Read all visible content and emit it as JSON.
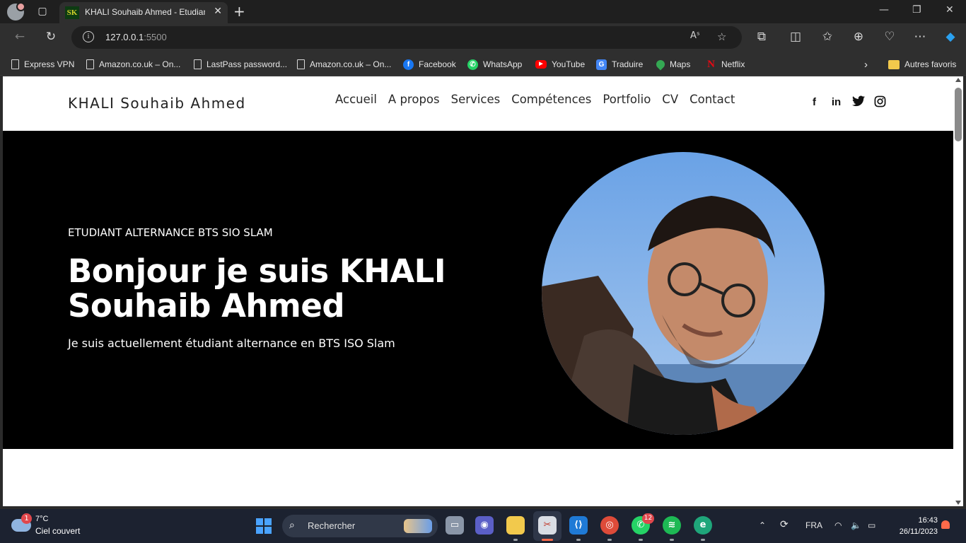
{
  "browser": {
    "tab": {
      "title": "KHALI Souhaib Ahmed - Etudiant",
      "favicon_text": "SK"
    },
    "url": {
      "host": "127.0.0.1",
      "port": ":5500"
    },
    "read_aloud_label": "Aˢ",
    "bookmarks": [
      {
        "label": "Express VPN",
        "icon": "page-icon"
      },
      {
        "label": "Amazon.co.uk – On...",
        "icon": "page-icon"
      },
      {
        "label": "LastPass password...",
        "icon": "page-icon"
      },
      {
        "label": "Amazon.co.uk – On...",
        "icon": "page-icon"
      },
      {
        "label": "Facebook",
        "icon": "facebook-icon"
      },
      {
        "label": "WhatsApp",
        "icon": "whatsapp-icon"
      },
      {
        "label": "YouTube",
        "icon": "youtube-icon"
      },
      {
        "label": "Traduire",
        "icon": "translate-icon"
      },
      {
        "label": "Maps",
        "icon": "maps-icon"
      },
      {
        "label": "Netflix",
        "icon": "netflix-icon"
      }
    ],
    "other_favorites": "Autres favoris"
  },
  "site": {
    "logo": "KHALI Souhaib Ahmed",
    "nav": [
      "Accueil",
      "A propos",
      "Services",
      "Compétences",
      "Portfolio",
      "CV",
      "Contact"
    ],
    "socials": [
      {
        "icon": "facebook-icon",
        "glyph": "f"
      },
      {
        "icon": "linkedin-icon",
        "glyph": "in"
      },
      {
        "icon": "twitter-icon",
        "glyph": "🐦"
      },
      {
        "icon": "instagram-icon",
        "glyph": "◎"
      }
    ],
    "hero": {
      "subtitle": "ETUDIANT ALTERNANCE BTS SIO SLAM",
      "title": "Bonjour je suis KHALI Souhaib Ahmed",
      "description": "Je suis actuellement étudiant alternance en BTS ISO Slam"
    }
  },
  "taskbar": {
    "weather": {
      "badge": "1",
      "temp": "7°C",
      "condition": "Ciel couvert"
    },
    "search_placeholder": "Rechercher",
    "whatsapp_badge": "12",
    "language": "FRA",
    "time": "16:43",
    "date": "26/11/2023"
  },
  "colors": {
    "hero_bg": "#000000",
    "page_bg": "#ffffff",
    "browser_chrome": "#2f2f2f",
    "taskbar": "#1c2230"
  }
}
